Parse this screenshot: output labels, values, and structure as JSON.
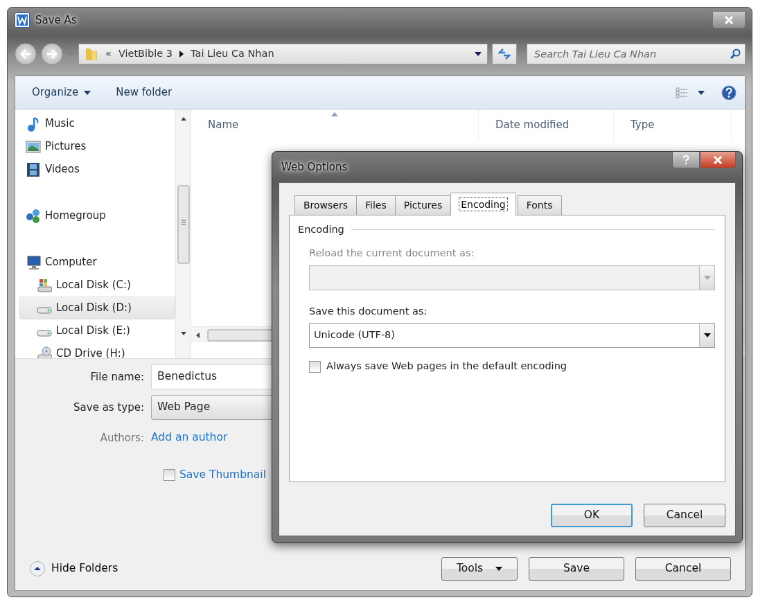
{
  "window": {
    "title": "Save As"
  },
  "address": {
    "overflow": "«",
    "crumbs": [
      "VietBible 3",
      "Tai Lieu Ca Nhan"
    ]
  },
  "search": {
    "placeholder": "Search Tai Lieu Ca Nhan"
  },
  "toolbar": [
    {
      "label": "Organize",
      "kind": "menu"
    },
    {
      "label": "New folder",
      "kind": "plain"
    }
  ],
  "nav": [
    {
      "label": "Music",
      "kind": "music",
      "selected": false
    },
    {
      "label": "Pictures",
      "kind": "pictures",
      "selected": false
    },
    {
      "label": "Videos",
      "kind": "videos",
      "selected": false
    },
    {
      "label": "Homegroup",
      "kind": "homegroup",
      "selected": false
    },
    {
      "label": "Computer",
      "kind": "computer",
      "selected": false,
      "children": [
        {
          "label": "Local Disk (C:)",
          "kind": "system-disk",
          "selected": false
        },
        {
          "label": "Local Disk (D:)",
          "kind": "disk",
          "selected": true
        },
        {
          "label": "Local Disk (E:)",
          "kind": "disk",
          "selected": false
        },
        {
          "label": "CD Drive (H:)",
          "kind": "cd",
          "selected": false
        }
      ]
    }
  ],
  "columns": [
    {
      "label": "Name",
      "sorted": true
    },
    {
      "label": "Date modified",
      "sorted": false
    },
    {
      "label": "Type",
      "sorted": false
    }
  ],
  "form": {
    "file_name": {
      "label": "File name:",
      "value": "Benedictus"
    },
    "save_as_type": {
      "label": "Save as type:",
      "value": "Web Page"
    },
    "authors": {
      "label": "Authors:",
      "link": "Add an author"
    },
    "thumbnail": {
      "label": "Save Thumbnail",
      "checked": false
    }
  },
  "hide_folders": "Hide Folders",
  "buttons": [
    {
      "label": "Tools",
      "kind": "menu"
    },
    {
      "label": "Save",
      "kind": "plain"
    },
    {
      "label": "Cancel",
      "kind": "plain"
    }
  ],
  "dialog": {
    "title": "Web Options",
    "tabs": [
      {
        "label": "Browsers",
        "selected": false
      },
      {
        "label": "Files",
        "selected": false
      },
      {
        "label": "Pictures",
        "selected": false
      },
      {
        "label": "Encoding",
        "selected": true
      },
      {
        "label": "Fonts",
        "selected": false
      }
    ],
    "group": "Encoding",
    "reload": {
      "label": "Reload the current document as:",
      "disabled": true
    },
    "save_as": {
      "label": "Save this document as:",
      "value": "Unicode (UTF-8)",
      "disabled": false
    },
    "always": {
      "label": "Always save Web pages in the default encoding",
      "checked": false
    },
    "buttons": [
      {
        "label": "OK",
        "default": true
      },
      {
        "label": "Cancel",
        "default": false
      }
    ]
  }
}
